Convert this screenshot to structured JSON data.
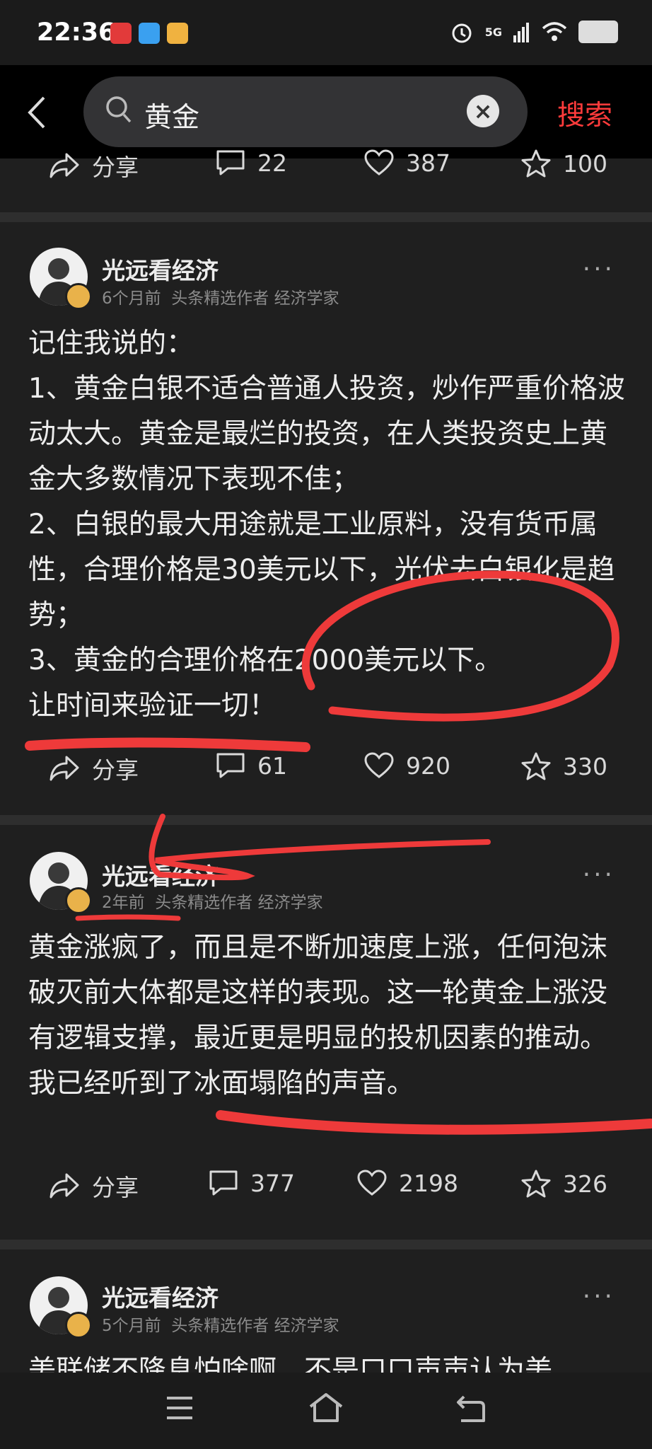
{
  "status_bar": {
    "time": "22:36",
    "network": "5G"
  },
  "search": {
    "query": "黄金",
    "submit_label": "搜索"
  },
  "top_actions": {
    "share": "分享",
    "comments": "22",
    "likes": "387",
    "favorites": "100"
  },
  "posts": [
    {
      "author": "光远看经济",
      "time": "6个月前",
      "tags": "头条精选作者 经济学家",
      "text": "记住我说的：\n1、黄金白银不适合普通人投资，炒作严重价格波动太大。黄金是最烂的投资，在人类投资史上黄金大多数情况下表现不佳；\n2、白银的最大用途就是工业原料，没有货币属性，合理价格是30美元以下，光伏去白银化是趋势；\n3、黄金的合理价格在2000美元以下。\n让时间来验证一切！",
      "share": "分享",
      "comments": "61",
      "likes": "920",
      "favorites": "330"
    },
    {
      "author": "光远看经济",
      "time": "2年前",
      "tags": "头条精选作者 经济学家",
      "text": "黄金涨疯了，而且是不断加速度上涨，任何泡沫破灭前大体都是这样的表现。这一轮黄金上涨没有逻辑支撑，最近更是明显的投机因素的推动。我已经听到了冰面塌陷的声音。",
      "share": "分享",
      "comments": "377",
      "likes": "2198",
      "favorites": "326"
    },
    {
      "author": "光远看经济",
      "time": "5个月前",
      "tags": "头条精选作者 经济学家",
      "text": "美联储不降息怕啥啊，不是口口声声认为美"
    }
  ],
  "colors": {
    "accent": "#ff3b3b",
    "annotation": "#ee3a3a",
    "background": "#1f1f1f"
  }
}
